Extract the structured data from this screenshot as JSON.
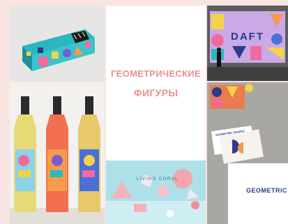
{
  "title": {
    "line1": "ГЕОМЕТРИЧЕСКИЕ",
    "line2": "ФИГУРЫ"
  },
  "billboard": {
    "text": "DAFT"
  },
  "render3d": {
    "label": "LIVING CORAL"
  },
  "stationery": {
    "card_text": "GEOMETRIC SHAPES",
    "letter_text": "GEOMETRIC SH"
  },
  "colors": {
    "accent": "#ec8f8f",
    "background": "#f8e4e0"
  }
}
